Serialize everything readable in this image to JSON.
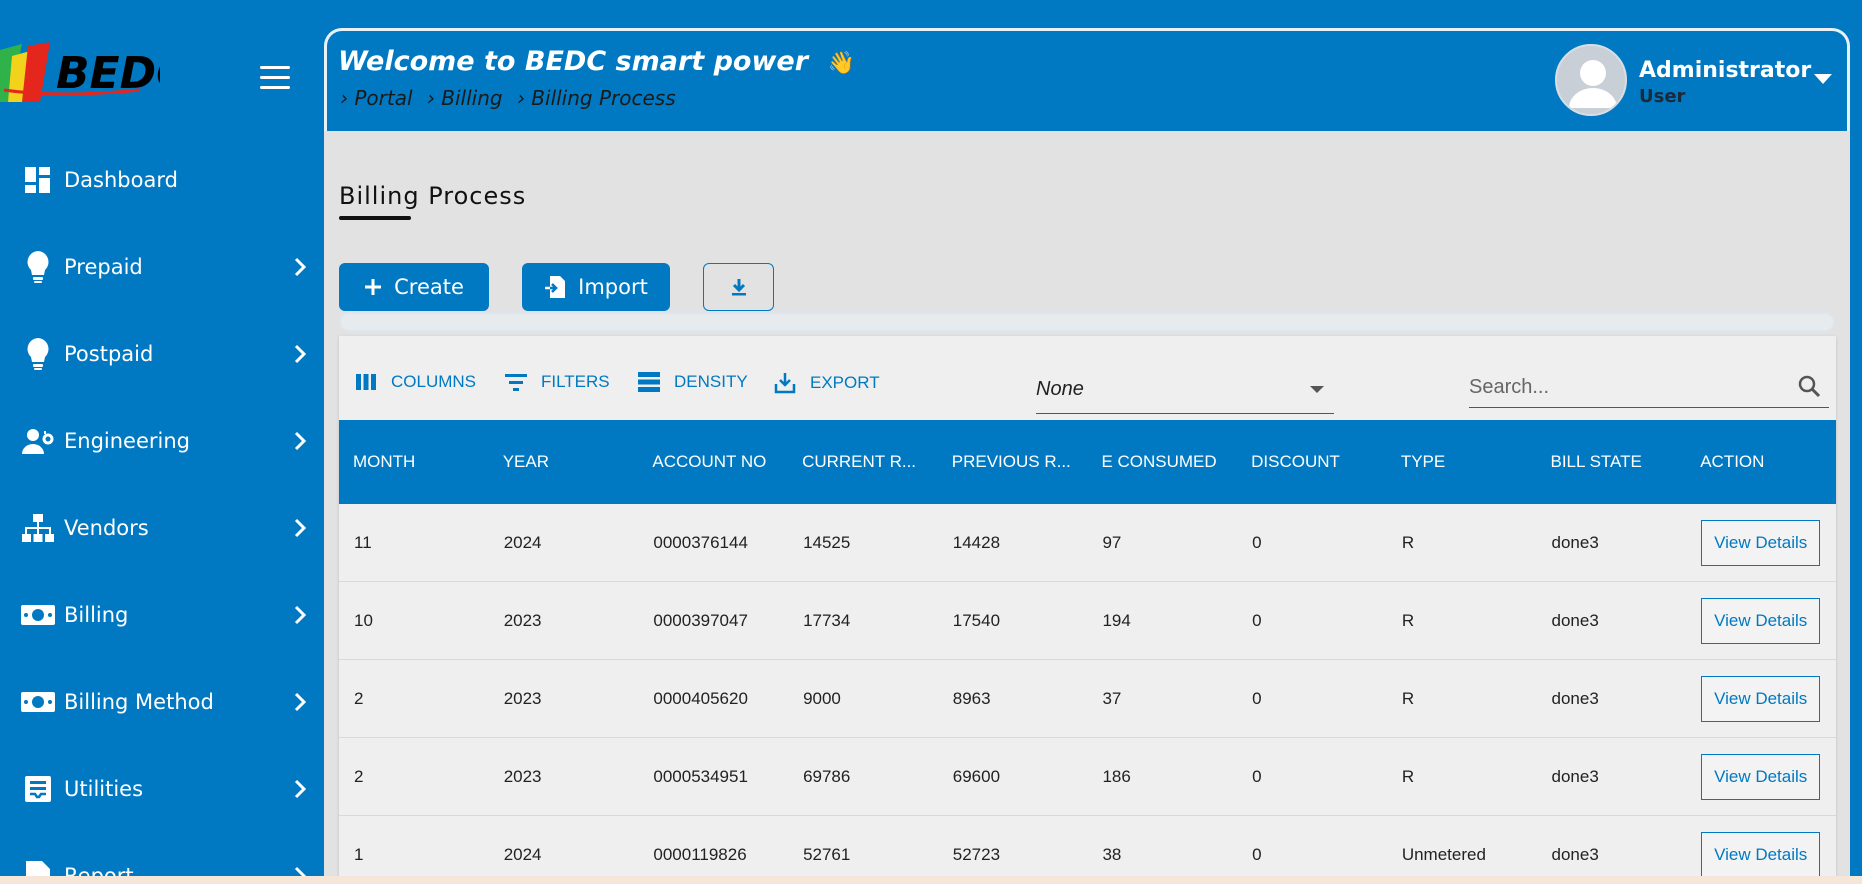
{
  "colors": {
    "brand": "#0079c2",
    "content_bg": "#e2e2e2",
    "text_dark": "#111111"
  },
  "sidebar": {
    "logo_text": "BEDC",
    "menu_icon": "hamburger-icon",
    "items": [
      {
        "label": "Dashboard",
        "icon": "dashboard-icon",
        "has_chevron": false
      },
      {
        "label": "Prepaid",
        "icon": "lightbulb-icon",
        "has_chevron": true
      },
      {
        "label": "Postpaid",
        "icon": "lightbulb-icon",
        "has_chevron": true
      },
      {
        "label": "Engineering",
        "icon": "engineer-icon",
        "has_chevron": true
      },
      {
        "label": "Vendors",
        "icon": "org-chart-icon",
        "has_chevron": true
      },
      {
        "label": "Billing",
        "icon": "money-icon",
        "has_chevron": true
      },
      {
        "label": "Billing Method",
        "icon": "money-icon",
        "has_chevron": true
      },
      {
        "label": "Utilities",
        "icon": "inbox-icon",
        "has_chevron": true
      },
      {
        "label": "Report",
        "icon": "report-icon",
        "has_chevron": true
      }
    ]
  },
  "header": {
    "welcome": "Welcome to BEDC smart power",
    "wave_emoji": "👋",
    "breadcrumb": [
      "› Portal",
      "› Billing",
      "› Billing Process"
    ],
    "user_name": "Administrator",
    "user_role": "User"
  },
  "page": {
    "title": "Billing Process",
    "create_label": "Create",
    "import_label": "Import"
  },
  "toolbar": {
    "columns_label": "COLUMNS",
    "filters_label": "FILTERS",
    "density_label": "DENSITY",
    "export_label": "EXPORT",
    "select_value": "None",
    "search_placeholder": "Search..."
  },
  "table": {
    "columns": [
      "MONTH",
      "YEAR",
      "ACCOUNT NO",
      "CURRENT R...",
      "PREVIOUS R...",
      "E CONSUMED",
      "DISCOUNT",
      "TYPE",
      "BILL STATE",
      "ACTION"
    ],
    "action_label": "View Details",
    "rows": [
      [
        "11",
        "2024",
        "0000376144",
        "14525",
        "14428",
        "97",
        "0",
        "R",
        "done3"
      ],
      [
        "10",
        "2023",
        "0000397047",
        "17734",
        "17540",
        "194",
        "0",
        "R",
        "done3"
      ],
      [
        "2",
        "2023",
        "0000405620",
        "9000",
        "8963",
        "37",
        "0",
        "R",
        "done3"
      ],
      [
        "2",
        "2023",
        "0000534951",
        "69786",
        "69600",
        "186",
        "0",
        "R",
        "done3"
      ],
      [
        "1",
        "2024",
        "0000119826",
        "52761",
        "52723",
        "38",
        "0",
        "Unmetered",
        "done3"
      ]
    ]
  }
}
